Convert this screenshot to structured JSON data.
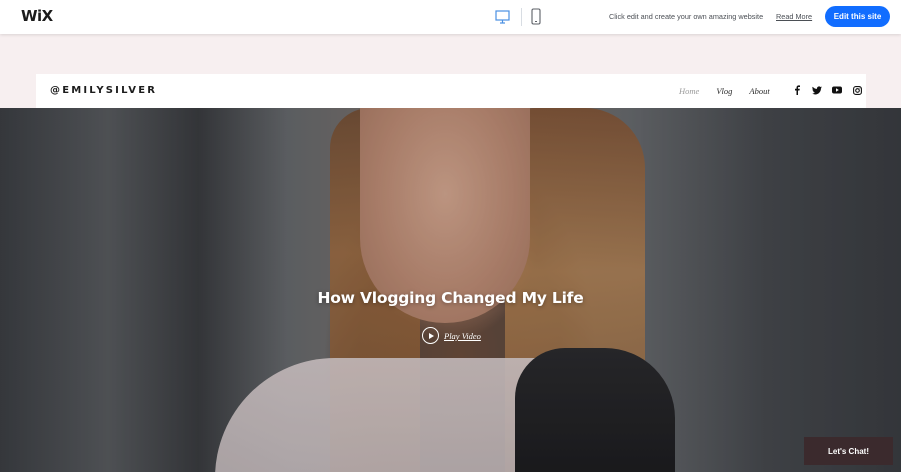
{
  "editor_bar": {
    "logo": "WiX",
    "tagline": "Click edit and create your own amazing website",
    "read_more": "Read More",
    "edit_button": "Edit this site",
    "icons": [
      "desktop-icon",
      "mobile-icon"
    ],
    "accent_color": "#116dff"
  },
  "site": {
    "logo": "@EMILYSILVER",
    "nav": [
      {
        "label": "Home",
        "active": true
      },
      {
        "label": "Vlog",
        "active": false
      },
      {
        "label": "About",
        "active": false
      }
    ],
    "social_icons": [
      "facebook-icon",
      "twitter-icon",
      "youtube-icon",
      "instagram-icon"
    ]
  },
  "hero": {
    "title": "How Vlogging Changed My Life",
    "play_label": "Play Video"
  },
  "chat": {
    "label": "Let's Chat!",
    "color": "#3b2a2d"
  }
}
